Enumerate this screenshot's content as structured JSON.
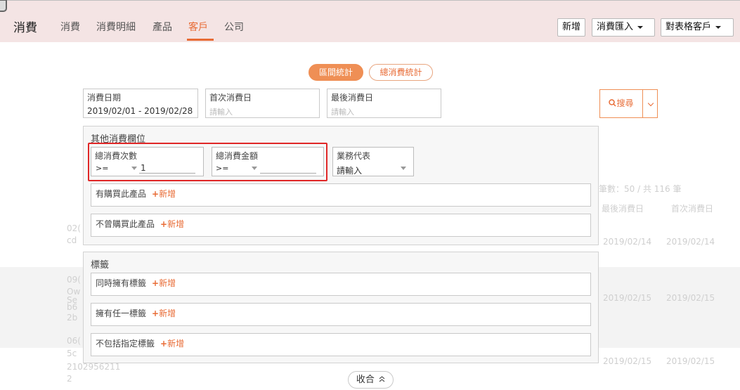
{
  "header": {
    "brand": "消費",
    "nav": [
      "消費",
      "消費明細",
      "產品",
      "客戶",
      "公司"
    ],
    "active_index": 3,
    "buttons": {
      "add": "新增",
      "import": "消費匯入",
      "export": "對表格客戶"
    }
  },
  "tabs": {
    "interval": "區間統計",
    "total": "總消費統計"
  },
  "filters": {
    "date": {
      "label": "消費日期",
      "value": "2019/02/01 - 2019/02/28"
    },
    "first": {
      "label": "首次消費日",
      "placeholder": "請輸入"
    },
    "last": {
      "label": "最後消費日",
      "placeholder": "請輸入"
    }
  },
  "search": {
    "label": "搜尋"
  },
  "other_panel": {
    "title": "其他消費欄位",
    "count": {
      "label": "總消費次數",
      "operator": ">=",
      "value": "1"
    },
    "amount": {
      "label": "總消費金額",
      "operator": ">=",
      "value": ""
    },
    "rep": {
      "label": "業務代表",
      "value": "請輸入"
    },
    "bought": "有購買此產品",
    "never": "不曾購買此產品",
    "add": "新增"
  },
  "tag_panel": {
    "title": "標籤",
    "all": "同時擁有標籤",
    "any": "擁有任一標籤",
    "exclude": "不包括指定標籤",
    "add": "新增"
  },
  "collapse": "收合",
  "background": {
    "count_text": "筆數：50 / 共 116 筆",
    "col_last": "最後消費日",
    "col_first": "首次消費日",
    "rows": [
      {
        "last": "2019/02/14",
        "first": "2019/02/14"
      },
      {
        "last": "2019/02/15",
        "first": "2019/02/15"
      },
      {
        "last": "2019/02/15",
        "first": "2019/02/15"
      }
    ],
    "fragments": [
      "02(",
      "cd",
      "09(",
      "Ow",
      "Se",
      "b6",
      "2b",
      "06(",
      "5c",
      "2102956211",
      "2"
    ]
  },
  "colors": {
    "accent": "#e86b35",
    "topbar": "#f4e4e4",
    "highlight": "#e02727"
  }
}
